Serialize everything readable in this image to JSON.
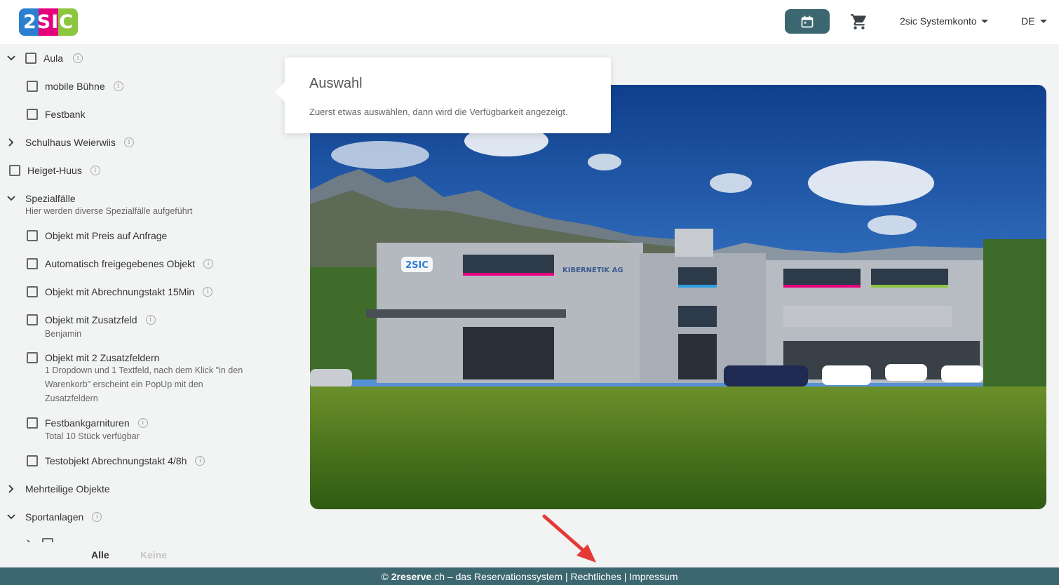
{
  "header": {
    "logo_text": "2SIC",
    "account_label": "2sic Systemkonto",
    "language": "DE"
  },
  "icons": {
    "calendar": "calendar-icon",
    "cart": "cart-icon"
  },
  "colors": {
    "primary": "#3d6770",
    "logo": [
      "#2b7fcf",
      "#e6007e",
      "#8cc63f"
    ]
  },
  "sidebar": {
    "aula": "Aula",
    "mobile_buehne": "mobile Bühne",
    "festbank": "Festbank",
    "schulhaus": "Schulhaus Weierwiis",
    "heiget": "Heiget-Huus",
    "spezial": "Spezialfälle",
    "spezial_desc": "Hier werden diverse Spezialfälle aufgeführt",
    "preis_anfrage": "Objekt mit Preis auf Anfrage",
    "auto_frei": "Automatisch freigegebenes Objekt",
    "takt15": "Objekt mit Abrechnungstakt 15Min",
    "zusatzfeld": "Objekt mit Zusatzfeld",
    "zusatzfeld_desc": "Benjamin",
    "zwei_zusatz": "Objekt mit 2 Zusatzfeldern",
    "zwei_zusatz_desc1": "1 Dropdown und 1 Textfeld, nach dem Klick \"in den",
    "zwei_zusatz_desc2": "Warenkorb\" erscheint ein PopUp mit den",
    "zwei_zusatz_desc3": "Zusatzfeldern",
    "festbankgarnituren": "Festbankgarnituren",
    "festbankgarnituren_desc": "Total 10 Stück verfügbar",
    "testobjekt": "Testobjekt Abrechnungstakt 4/8h",
    "mehrteilig": "Mehrteilige Objekte",
    "sport": "Sportanlagen",
    "tab_all": "Alle",
    "tab_none": "Keine"
  },
  "popover": {
    "title": "Auswahl",
    "body": "Zuerst etwas auswählen, dann wird die Verfügbarkeit angezeigt."
  },
  "photo": {
    "facade_sign": "KIBERNETIK AG",
    "badge": "2SIC"
  },
  "footer": {
    "copyright": "©",
    "brand": "2reserve",
    "rest": ".ch – das Reservationssystem | Rechtliches | Impressum"
  }
}
